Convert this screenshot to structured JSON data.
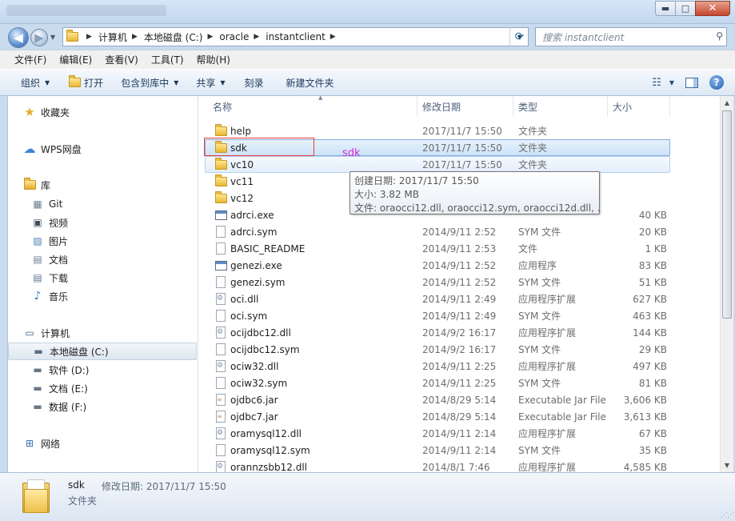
{
  "window": {
    "controls": {
      "minimize": "▬",
      "maximize": "□",
      "close": "✕"
    }
  },
  "address": {
    "crumbs": [
      "计算机",
      "本地磁盘 (C:)",
      "oracle",
      "instantclient"
    ],
    "search_placeholder": "搜索 instantclient"
  },
  "menu": [
    "文件(F)",
    "编辑(E)",
    "查看(V)",
    "工具(T)",
    "帮助(H)"
  ],
  "toolbar": {
    "organize": "组织",
    "open": "打开",
    "include_library": "包含到库中",
    "share": "共享",
    "burn": "刻录",
    "new_folder": "新建文件夹"
  },
  "sidebar": {
    "favorites": "收藏夹",
    "wps": "WPS网盘",
    "libraries": "库",
    "lib_items": [
      "Git",
      "视频",
      "图片",
      "文档",
      "下载",
      "音乐"
    ],
    "computer": "计算机",
    "drives": [
      "本地磁盘 (C:)",
      "软件 (D:)",
      "文档 (E:)",
      "数据 (F:)"
    ],
    "network": "网络"
  },
  "columns": {
    "name": "名称",
    "date": "修改日期",
    "type": "类型",
    "size": "大小"
  },
  "files": [
    {
      "name": "help",
      "date": "2017/11/7 15:50",
      "type": "文件夹",
      "size": "",
      "icon": "folder"
    },
    {
      "name": "sdk",
      "date": "2017/11/7 15:50",
      "type": "文件夹",
      "size": "",
      "icon": "folder"
    },
    {
      "name": "vc10",
      "date": "2017/11/7 15:50",
      "type": "文件夹",
      "size": "",
      "icon": "folder"
    },
    {
      "name": "vc11",
      "date": "",
      "type": "",
      "size": "",
      "icon": "folder"
    },
    {
      "name": "vc12",
      "date": "",
      "type": "",
      "size": "",
      "icon": "folder"
    },
    {
      "name": "adrci.exe",
      "date": "",
      "type": "",
      "size": "40 KB",
      "icon": "exe"
    },
    {
      "name": "adrci.sym",
      "date": "2014/9/11 2:52",
      "type": "SYM 文件",
      "size": "20 KB",
      "icon": "file"
    },
    {
      "name": "BASIC_README",
      "date": "2014/9/11 2:53",
      "type": "文件",
      "size": "1 KB",
      "icon": "file"
    },
    {
      "name": "genezi.exe",
      "date": "2014/9/11 2:52",
      "type": "应用程序",
      "size": "83 KB",
      "icon": "exe"
    },
    {
      "name": "genezi.sym",
      "date": "2014/9/11 2:52",
      "type": "SYM 文件",
      "size": "51 KB",
      "icon": "file"
    },
    {
      "name": "oci.dll",
      "date": "2014/9/11 2:49",
      "type": "应用程序扩展",
      "size": "627 KB",
      "icon": "dll"
    },
    {
      "name": "oci.sym",
      "date": "2014/9/11 2:49",
      "type": "SYM 文件",
      "size": "463 KB",
      "icon": "file"
    },
    {
      "name": "ocijdbc12.dll",
      "date": "2014/9/2 16:17",
      "type": "应用程序扩展",
      "size": "144 KB",
      "icon": "dll"
    },
    {
      "name": "ocijdbc12.sym",
      "date": "2014/9/2 16:17",
      "type": "SYM 文件",
      "size": "29 KB",
      "icon": "file"
    },
    {
      "name": "ociw32.dll",
      "date": "2014/9/11 2:25",
      "type": "应用程序扩展",
      "size": "497 KB",
      "icon": "dll"
    },
    {
      "name": "ociw32.sym",
      "date": "2014/9/11 2:25",
      "type": "SYM 文件",
      "size": "81 KB",
      "icon": "file"
    },
    {
      "name": "ojdbc6.jar",
      "date": "2014/8/29 5:14",
      "type": "Executable Jar File",
      "size": "3,606 KB",
      "icon": "jar"
    },
    {
      "name": "ojdbc7.jar",
      "date": "2014/8/29 5:14",
      "type": "Executable Jar File",
      "size": "3,613 KB",
      "icon": "jar"
    },
    {
      "name": "oramysql12.dll",
      "date": "2014/9/11 2:14",
      "type": "应用程序扩展",
      "size": "67 KB",
      "icon": "dll"
    },
    {
      "name": "oramysql12.sym",
      "date": "2014/9/11 2:14",
      "type": "SYM 文件",
      "size": "35 KB",
      "icon": "file"
    },
    {
      "name": "orannzsbb12.dll",
      "date": "2014/8/1 7:46",
      "type": "应用程序扩展",
      "size": "4,585 KB",
      "icon": "dll"
    }
  ],
  "tooltip": {
    "line1": "创建日期: 2017/11/7 15:50",
    "line2": "大小: 3.82 MB",
    "line3": "文件: oraocci12.dll, oraocci12.sym, oraocci12d.dll, ..."
  },
  "annotation": "sdk",
  "details": {
    "name": "sdk",
    "label": "修改日期: 2017/11/7 15:50",
    "type": "文件夹"
  }
}
